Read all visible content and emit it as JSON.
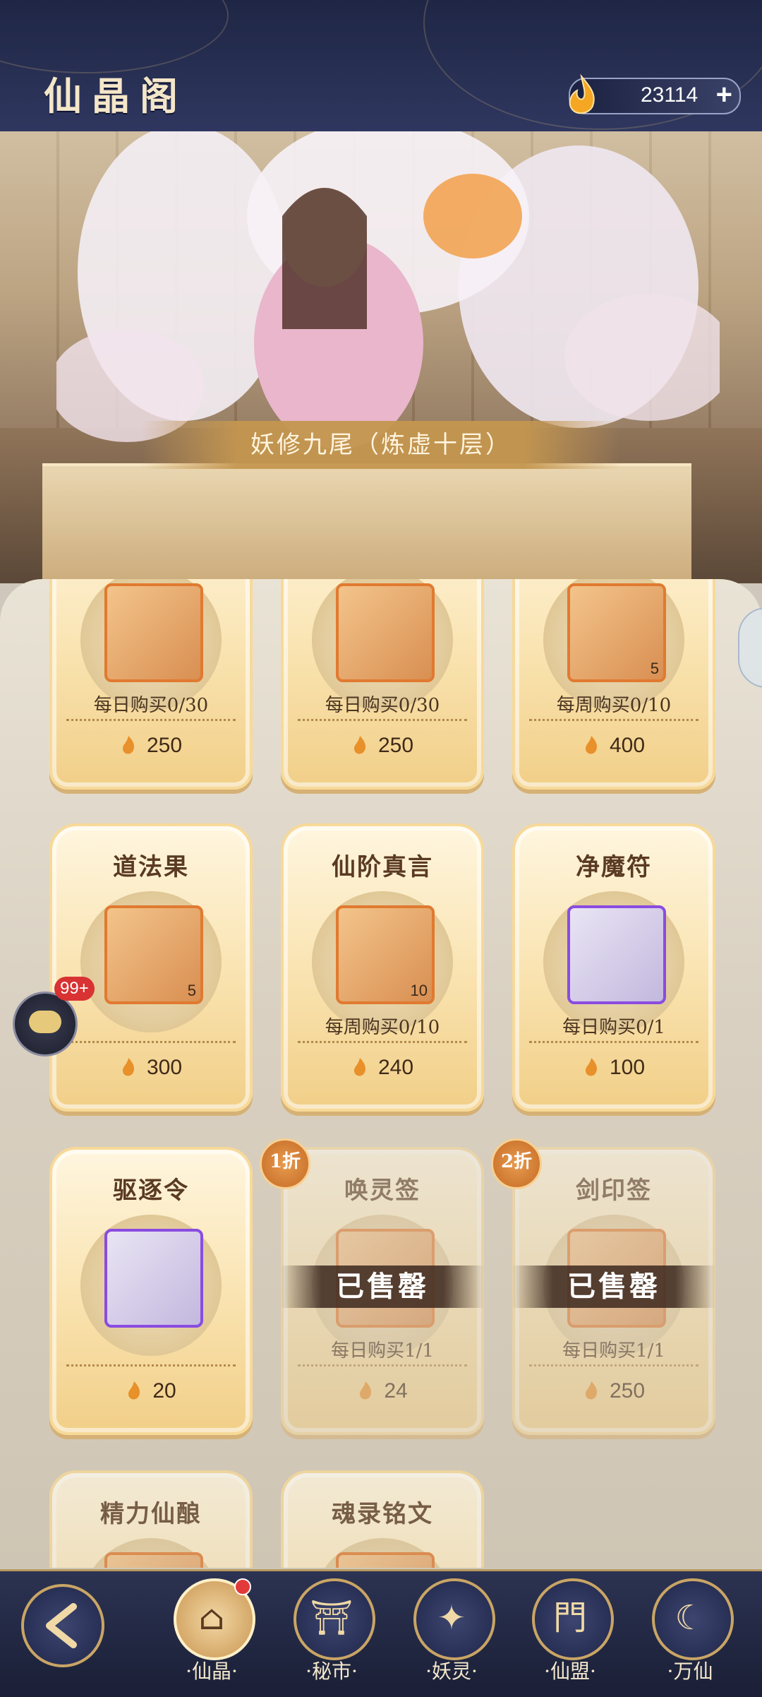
{
  "header": {
    "title": "仙晶阁",
    "currency_amount": "23114",
    "plus_label": "+"
  },
  "banner": {
    "character_name": "妖修九尾（炼虚十层）"
  },
  "cards": [
    {
      "name": "",
      "limit": "每日购买0/30",
      "price": "250",
      "count": "",
      "frame": "orange"
    },
    {
      "name": "",
      "limit": "每日购买0/30",
      "price": "250",
      "count": "",
      "frame": "orange"
    },
    {
      "name": "",
      "limit": "每周购买0/10",
      "price": "400",
      "count": "5",
      "frame": "orange"
    },
    {
      "name": "道法果",
      "limit": "",
      "price": "300",
      "count": "5",
      "frame": "orange"
    },
    {
      "name": "仙阶真言",
      "limit": "每周购买0/10",
      "price": "240",
      "count": "10",
      "frame": "orange"
    },
    {
      "name": "净魔符",
      "limit": "每日购买0/1",
      "price": "100",
      "count": "",
      "frame": "purple"
    },
    {
      "name": "驱逐令",
      "limit": "",
      "price": "20",
      "count": "",
      "frame": "purple"
    },
    {
      "name": "唤灵签",
      "limit": "每日购买1/1",
      "price": "24",
      "count": "",
      "frame": "orange",
      "sold": "已售罄",
      "discount": "1折"
    },
    {
      "name": "剑印签",
      "limit": "每日购买1/1",
      "price": "250",
      "count": "",
      "frame": "orange",
      "sold": "已售罄",
      "discount": "2折"
    },
    {
      "name": "精力仙酿",
      "limit": "",
      "price": "",
      "count": "",
      "frame": "orange"
    },
    {
      "name": "魂录铭文",
      "limit": "",
      "price": "",
      "count": "",
      "frame": "orange"
    }
  ],
  "chat": {
    "badge": "99+"
  },
  "nav": {
    "items": [
      {
        "label": "·仙晶·",
        "glyph": "⌂"
      },
      {
        "label": "·秘市·",
        "glyph": "⛩"
      },
      {
        "label": "·妖灵·",
        "glyph": "✦"
      },
      {
        "label": "·仙盟·",
        "glyph": "門"
      },
      {
        "label": "·万仙",
        "glyph": "☾"
      }
    ]
  },
  "colors": {
    "accent": "#c9a565",
    "header_bg": "#283054",
    "sold_overlay": "#3c281e"
  }
}
